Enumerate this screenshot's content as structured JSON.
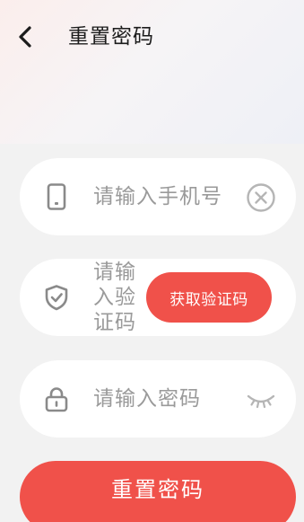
{
  "header": {
    "back_icon": "chevron-left-icon",
    "title": "重置密码"
  },
  "form": {
    "phone": {
      "placeholder": "请输入手机号",
      "icon": "phone-icon",
      "clear_icon": "clear-circle-icon"
    },
    "code": {
      "placeholder": "请输入验证码",
      "icon": "shield-check-icon",
      "send_code_label": "获取验证码"
    },
    "password": {
      "placeholder": "请输入密码",
      "icon": "lock-icon",
      "visibility_icon": "eye-closed-icon"
    },
    "submit_label": "重置密码"
  },
  "colors": {
    "accent": "#f0514a",
    "field_background": "#ffffff",
    "page_background": "#f2f2f2",
    "icon_gray": "#8a8a8a",
    "placeholder_gray": "#9a9a9a"
  }
}
